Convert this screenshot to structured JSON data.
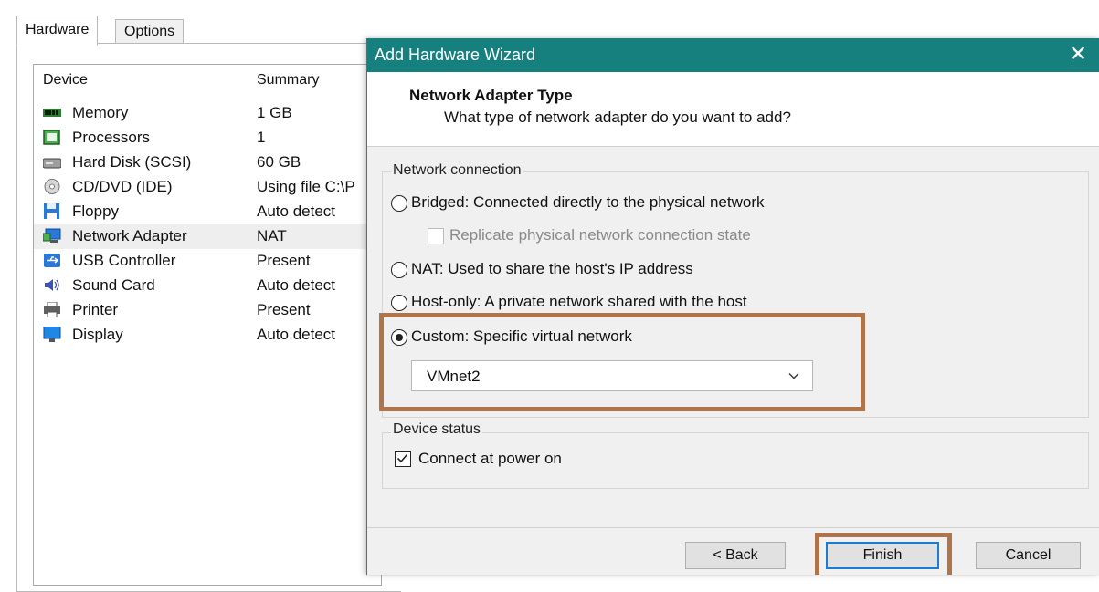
{
  "tabs": [
    {
      "label": "Hardware",
      "active": true
    },
    {
      "label": "Options",
      "active": false
    }
  ],
  "device_list": {
    "columns": {
      "device": "Device",
      "summary": "Summary"
    },
    "rows": [
      {
        "icon": "memory-icon",
        "name": "Memory",
        "summary": "1 GB",
        "selected": false
      },
      {
        "icon": "processor-icon",
        "name": "Processors",
        "summary": "1",
        "selected": false
      },
      {
        "icon": "hard-disk-icon",
        "name": "Hard Disk (SCSI)",
        "summary": "60 GB",
        "selected": false
      },
      {
        "icon": "cd-dvd-icon",
        "name": "CD/DVD (IDE)",
        "summary": "Using file C:\\P",
        "selected": false
      },
      {
        "icon": "floppy-icon",
        "name": "Floppy",
        "summary": "Auto detect",
        "selected": false
      },
      {
        "icon": "network-adapter-icon",
        "name": "Network Adapter",
        "summary": "NAT",
        "selected": true
      },
      {
        "icon": "usb-icon",
        "name": "USB Controller",
        "summary": "Present",
        "selected": false
      },
      {
        "icon": "sound-card-icon",
        "name": "Sound Card",
        "summary": "Auto detect",
        "selected": false
      },
      {
        "icon": "printer-icon",
        "name": "Printer",
        "summary": "Present",
        "selected": false
      },
      {
        "icon": "display-icon",
        "name": "Display",
        "summary": "Auto detect",
        "selected": false
      }
    ]
  },
  "dialog": {
    "title": "Add Hardware Wizard",
    "close_glyph": "✕",
    "header_title": "Network Adapter Type",
    "header_subtitle": "What type of network adapter do you want to add?",
    "network_group": {
      "legend": "Network connection",
      "options": {
        "bridged": "Bridged: Connected directly to the physical network",
        "replicate": "Replicate physical network connection state",
        "nat": "NAT: Used to share the host's IP address",
        "host_only": "Host-only: A private network shared with the host",
        "custom": "Custom: Specific virtual network"
      },
      "selected": "custom",
      "replicate_checked": false,
      "replicate_enabled": false,
      "custom_network_value": "VMnet2"
    },
    "device_status_group": {
      "legend": "Device status",
      "connect_label": "Connect at power on",
      "connect_checked": true
    },
    "buttons": {
      "back": "< Back",
      "finish": "Finish",
      "cancel": "Cancel"
    }
  },
  "colors": {
    "titlebar": "#16807f",
    "highlight": "#b0744b",
    "focus": "#1b7cd4"
  }
}
